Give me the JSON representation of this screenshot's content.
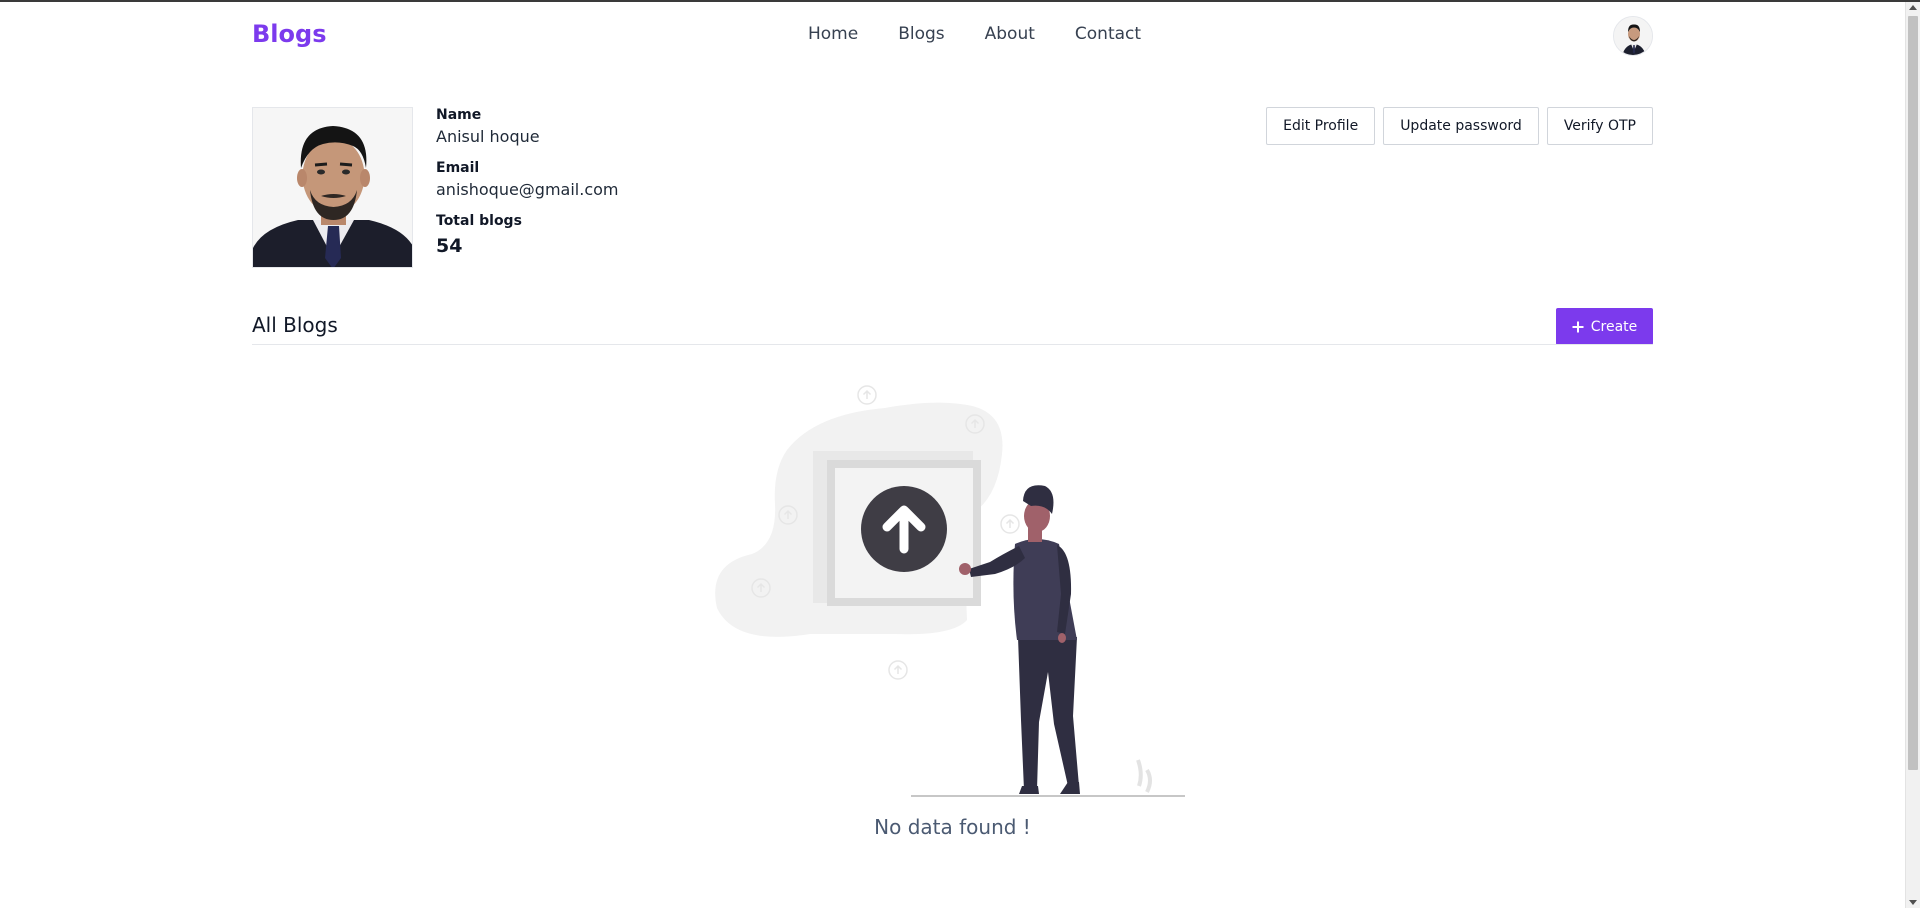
{
  "nav": {
    "brand": "Blogs",
    "links": [
      "Home",
      "Blogs",
      "About",
      "Contact"
    ]
  },
  "profile": {
    "name_label": "Name",
    "name": "Anisul hoque",
    "email_label": "Email",
    "email": "anishoque@gmail.com",
    "total_label": "Total blogs",
    "total": "54"
  },
  "actions": {
    "edit": "Edit Profile",
    "update_password": "Update password",
    "verify_otp": "Verify OTP"
  },
  "blogs": {
    "title": "All Blogs",
    "create": "Create",
    "empty": "No data found !"
  },
  "icons": {
    "create": "plus-icon",
    "upload": "arrow-up-icon"
  },
  "colors": {
    "brand": "#7c3aed",
    "empty_text": "#4b5a72"
  }
}
